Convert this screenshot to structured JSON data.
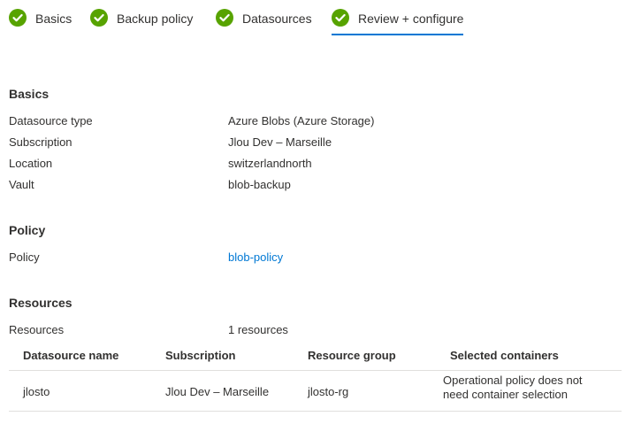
{
  "steps": [
    {
      "label": "Basics"
    },
    {
      "label": "Backup policy"
    },
    {
      "label": "Datasources"
    },
    {
      "label": "Review + configure"
    }
  ],
  "colors": {
    "check": "#57a300",
    "link": "#0078d4",
    "accent": "#0078d4"
  },
  "basics": {
    "title": "Basics",
    "rows": [
      {
        "label": "Datasource type",
        "value": "Azure Blobs (Azure Storage)"
      },
      {
        "label": "Subscription",
        "value": "Jlou Dev – Marseille"
      },
      {
        "label": "Location",
        "value": "switzerlandnorth"
      },
      {
        "label": "Vault",
        "value": "blob-backup"
      }
    ]
  },
  "policy": {
    "title": "Policy",
    "label": "Policy",
    "value": "blob-policy"
  },
  "resources": {
    "title": "Resources",
    "label": "Resources",
    "value": "1 resources",
    "columns": [
      "Datasource name",
      "Subscription",
      "Resource group",
      "Selected containers"
    ],
    "rows": [
      {
        "name": "jlosto",
        "subscription": "Jlou Dev – Marseille",
        "resource_group": "jlosto-rg",
        "containers": "Operational policy does not need container selection"
      }
    ]
  }
}
